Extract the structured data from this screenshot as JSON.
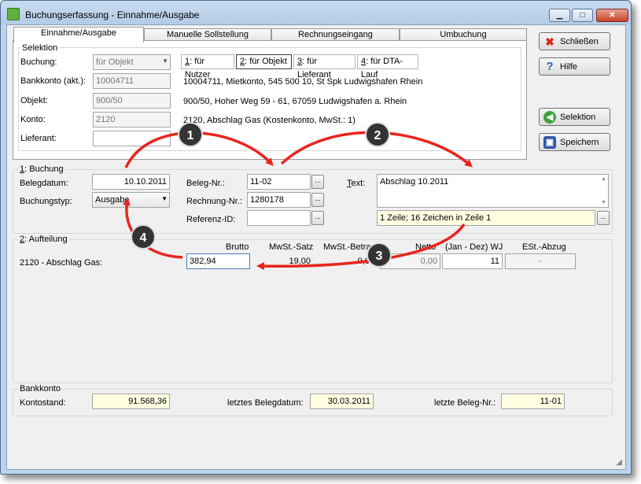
{
  "window": {
    "title": "Buchungserfassung - Einnahme/Ausgabe",
    "minimize_icon": "minimize-icon",
    "maximize_icon": "maximize-icon",
    "close_icon": "close-icon"
  },
  "tabs": [
    "Einnahme/Ausgabe",
    "Manuelle Sollstellung",
    "Rechnungseingang",
    "Umbuchung"
  ],
  "selektion": {
    "title": "Selektion",
    "buchung_label": "Buchung:",
    "buchung_value": "für Objekt",
    "bankkonto_label": "Bankkonto (akt.):",
    "bankkonto_value": "10004711",
    "objekt_label": "Objekt:",
    "objekt_value": "900/50",
    "konto_label": "Konto:",
    "konto_value": "2120",
    "lieferant_label": "Lieferant:",
    "lieferant_value": "",
    "options": [
      {
        "key": "1",
        "text": ": für Nutzer"
      },
      {
        "key": "2",
        "text": ": für Objekt"
      },
      {
        "key": "3",
        "text": ": für Lieferant"
      },
      {
        "key": "4",
        "text": ": für DTA-Lauf"
      }
    ],
    "bankkonto_desc": "10004711,  Mietkonto,  545 500 10,  St Spk Ludwigshafen Rhein",
    "objekt_desc": "900/50,  Hoher Weg 59 - 61, 67059 Ludwigshafen a. Rhein",
    "konto_desc": "2120,  Abschlag Gas  (Kostenkonto,  MwSt.: 1)"
  },
  "buchung": {
    "title_key": "1",
    "title_rest": ": Buchung",
    "belegdatum_label": "Belegdatum:",
    "belegdatum_value": "10.10.2011",
    "buchungstyp_label": "Buchungstyp:",
    "buchungstyp_value": "Ausgabe",
    "belegnr_label": "Beleg-Nr.:",
    "belegnr_value": "11-02",
    "rechnungnr_label": "Rechnung-Nr.:",
    "rechnungnr_value": "1280178",
    "referenz_label": "Referenz-ID:",
    "referenz_value": "",
    "text_label_key": "T",
    "text_label_rest": "ext:",
    "text_value": "Abschlag 10.2011",
    "text_info": "1 Zeile; 16 Zeichen in Zeile 1",
    "dots": "..."
  },
  "aufteilung": {
    "title_key": "2",
    "title_rest": ": Aufteilung",
    "headers": [
      "Brutto",
      "MwSt.-Satz",
      "MwSt.-Betrag",
      "Netto",
      "(Jan - Dez) WJ",
      "ESt.-Abzug"
    ],
    "row_label": "2120 - Abschlag Gas:",
    "brutto": "382,94",
    "mwst_satz": "19,00",
    "mwst_betrag": "0,00",
    "netto": "0,00",
    "wj": "11",
    "est": "-"
  },
  "bankkonto": {
    "title": "Bankkonto",
    "kontostand_label": "Kontostand:",
    "kontostand_value": "91.568,36",
    "letztes_datum_label": "letztes Belegdatum:",
    "letztes_datum_value": "30.03.2011",
    "letzte_nr_label": "letzte Beleg-Nr.:",
    "letzte_nr_value": "11-01"
  },
  "buttons": {
    "schliessen": "Schließen",
    "hilfe": "Hilfe",
    "selektion": "Selektion",
    "speichern": "Speichern"
  },
  "annotations": [
    "1",
    "2",
    "3",
    "4"
  ],
  "colors": {
    "arrow": "#e8251f",
    "badge": "#3a3a3a",
    "field_yellow": "#fffee1"
  }
}
